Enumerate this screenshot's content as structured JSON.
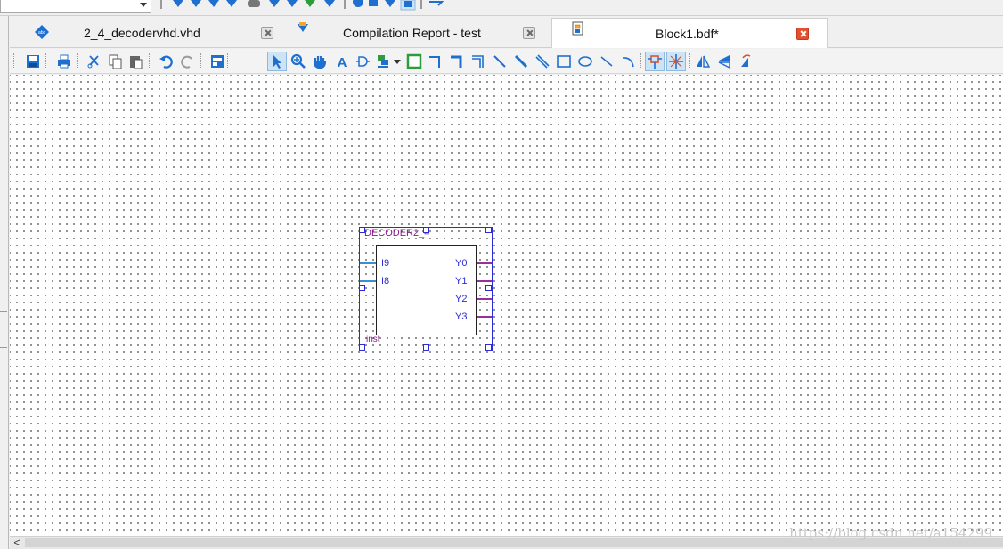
{
  "tabs": [
    {
      "label": "2_4_decodervhd.vhd",
      "icon": "vhdl-file-icon",
      "active": false
    },
    {
      "label": "Compilation Report - test",
      "icon": "compilation-report-icon",
      "active": false
    },
    {
      "label": "Block1.bdf*",
      "icon": "block-diagram-file-icon",
      "active": true
    }
  ],
  "toolbar": {
    "tools": [
      "save",
      "print",
      "cut",
      "copy",
      "paste",
      "undo",
      "redo",
      "block-editor-view",
      "selection-tool",
      "zoom-tool",
      "hand-tool",
      "text-tool",
      "symbol-tool",
      "pin-tool",
      "block-tool",
      "orthogonal-node-tool",
      "orthogonal-bus-tool",
      "orthogonal-conduit-tool",
      "diagonal-node-tool",
      "diagonal-bus-tool",
      "diagonal-conduit-tool",
      "rectangle-tool",
      "oval-tool",
      "line-tool",
      "arc-tool",
      "partial-line-selection",
      "rubberbanding",
      "flip-horizontal",
      "flip-vertical",
      "rotate-left"
    ],
    "accent": "#1f6fd1"
  },
  "symbol": {
    "name": "DECODER2_4",
    "instance": "inst",
    "inputs": [
      "I9",
      "I8"
    ],
    "outputs": [
      "Y0",
      "Y1",
      "Y2",
      "Y3"
    ],
    "border_color": "#2b2bd8",
    "label_color": "#8b1a8b"
  },
  "watermark": "https://blog.csdn.net/a154299",
  "scroll": {
    "left_arrow": "<"
  }
}
